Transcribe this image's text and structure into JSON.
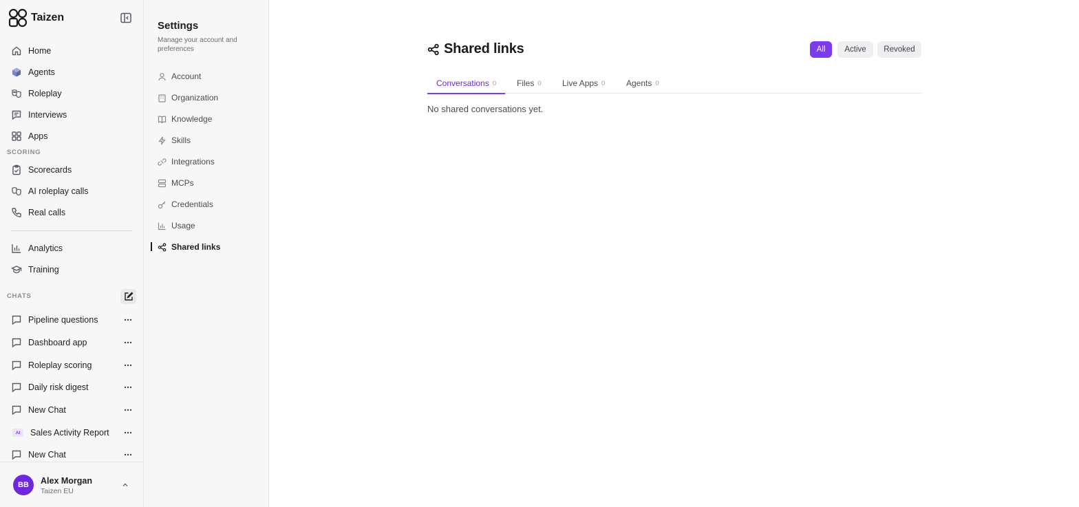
{
  "app": {
    "name": "Taizen"
  },
  "sidebar": {
    "nav": [
      {
        "label": "Home",
        "icon": "home-icon"
      },
      {
        "label": "Agents",
        "icon": "cube-icon"
      },
      {
        "label": "Roleplay",
        "icon": "masks-icon"
      },
      {
        "label": "Interviews",
        "icon": "message-square-icon"
      },
      {
        "label": "Apps",
        "icon": "grid-icon"
      }
    ],
    "scoring_label": "SCORING",
    "scoring": [
      {
        "label": "Scorecards",
        "icon": "clipboard-check-icon"
      },
      {
        "label": "AI roleplay calls",
        "icon": "masks-icon"
      },
      {
        "label": "Real calls",
        "icon": "phone-icon"
      }
    ],
    "tools": [
      {
        "label": "Analytics",
        "icon": "bar-chart-icon"
      },
      {
        "label": "Training",
        "icon": "graduation-cap-icon"
      }
    ],
    "chats_label": "CHATS",
    "chats": [
      {
        "label": "Pipeline questions",
        "icon": "chat-icon"
      },
      {
        "label": "Dashboard app",
        "icon": "chat-icon"
      },
      {
        "label": "Roleplay scoring",
        "icon": "chat-icon"
      },
      {
        "label": "Daily risk digest",
        "icon": "chat-icon"
      },
      {
        "label": "New Chat",
        "icon": "chat-icon"
      },
      {
        "label": "Sales Activity Report",
        "icon": "ai-badge",
        "badge": "AI"
      },
      {
        "label": "New Chat",
        "icon": "chat-icon"
      }
    ],
    "user": {
      "initials": "BB",
      "name": "Alex Morgan",
      "org": "Taizen EU"
    }
  },
  "settings": {
    "title": "Settings",
    "subtitle": "Manage your account and preferences",
    "items": [
      {
        "label": "Account",
        "icon": "user-icon"
      },
      {
        "label": "Organization",
        "icon": "building-icon"
      },
      {
        "label": "Knowledge",
        "icon": "book-icon"
      },
      {
        "label": "Skills",
        "icon": "bolt-icon"
      },
      {
        "label": "Integrations",
        "icon": "plug-icon"
      },
      {
        "label": "MCPs",
        "icon": "server-icon"
      },
      {
        "label": "Credentials",
        "icon": "key-icon"
      },
      {
        "label": "Usage",
        "icon": "bar-chart-icon"
      },
      {
        "label": "Shared links",
        "icon": "share-icon",
        "active": true
      }
    ]
  },
  "main": {
    "title": "Shared links",
    "filters": {
      "all": "All",
      "active": "Active",
      "revoked": "Revoked",
      "selected": "All"
    },
    "tabs": [
      {
        "label": "Conversations",
        "count": "0"
      },
      {
        "label": "Files",
        "count": "0"
      },
      {
        "label": "Live Apps",
        "count": "0"
      },
      {
        "label": "Agents",
        "count": "0"
      }
    ],
    "selected_tab": "Conversations",
    "empty_message": "No shared conversations yet."
  },
  "colors": {
    "accent": "#7c3aed",
    "avatar": "#6d28d9",
    "sidebar_bg": "#f7f7f8"
  }
}
